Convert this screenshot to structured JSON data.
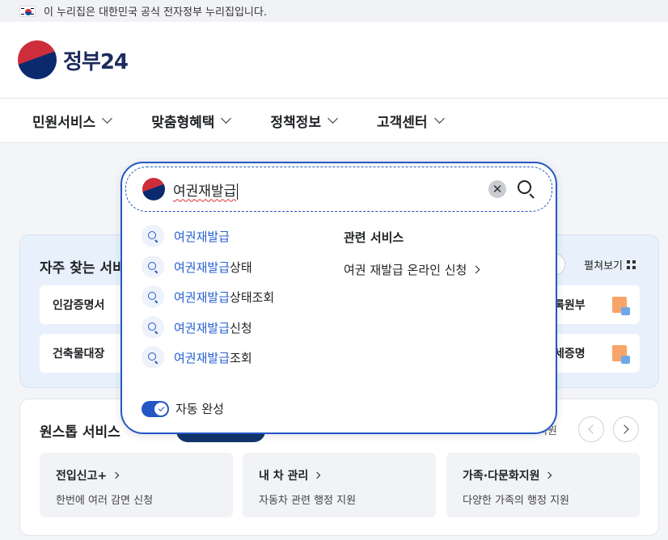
{
  "banner": {
    "text": "이 누리집은 대한민국 공식 전자정부 누리집입니다."
  },
  "header": {
    "logo_text": "정부",
    "logo_number": "24"
  },
  "nav": [
    {
      "label": "민원서비스"
    },
    {
      "label": "맞춤형혜택"
    },
    {
      "label": "정책정보"
    },
    {
      "label": "고객센터"
    }
  ],
  "frequent": {
    "title": "자주 찾는 서비",
    "expand_label": "펼쳐보기",
    "left_items": [
      "인감증명서",
      "건축물대장"
    ],
    "right_items": [
      "록원부",
      "세증명"
    ]
  },
  "onestop": {
    "title": "원스톱 서비스",
    "fragment": "지원",
    "cards": [
      {
        "title": "전입신고+",
        "desc": "한번에 여러 감면 신청"
      },
      {
        "title": "내 차 관리",
        "desc": "자동차 관련 행정 지원"
      },
      {
        "title": "가족·다문화지원",
        "desc": "다양한 가족의 행정 지원"
      }
    ]
  },
  "search": {
    "query": "여권재발급",
    "suggestions": [
      {
        "match": "여권재발급",
        "rest": ""
      },
      {
        "match": "여권재발급",
        "rest": "상태"
      },
      {
        "match": "여권재발급",
        "rest": "상태조회"
      },
      {
        "match": "여권재발급",
        "rest": "신청"
      },
      {
        "match": "여권재발급",
        "rest": "조회"
      }
    ],
    "related_title": "관련 서비스",
    "related_link": "여권 재발급 온라인 신청",
    "autocomplete_label": "자동 완성",
    "clear_glyph": "✕"
  }
}
